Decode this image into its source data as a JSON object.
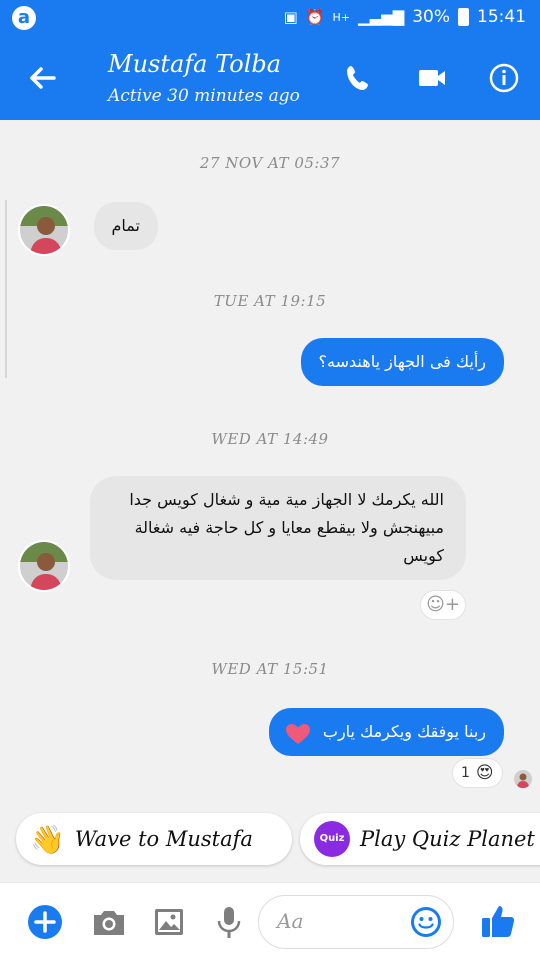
{
  "status_bar": {
    "battery": "30%",
    "time": "15:41",
    "network": "H+"
  },
  "header": {
    "contact_name": "Mustafa Tolba",
    "active_status": "Active 30 minutes ago"
  },
  "messages": [
    {
      "timestamp": "27 NOV AT 05:37"
    },
    {
      "direction": "incoming",
      "text": "تمام"
    },
    {
      "timestamp": "TUE AT 19:15"
    },
    {
      "direction": "outgoing",
      "text": "رأيك فى الجهاز ياهندسه؟"
    },
    {
      "timestamp": "WED AT 14:49"
    },
    {
      "direction": "incoming",
      "text": "الله يكرمك لا الجهاز مية مية و شغال كويس جدا مبيهنجش ولا بيقطع معايا و كل حاجة فيه شغالة كويس"
    },
    {
      "timestamp": "WED AT 15:51"
    },
    {
      "direction": "outgoing",
      "text": "ربنا يوفقك ويكرمك يارب",
      "reaction_count": "1"
    }
  ],
  "suggestions": [
    {
      "label": "Wave to Mustafa",
      "icon": "wave-hand-icon"
    },
    {
      "label": "Play Quiz Planet",
      "icon": "quiz-icon",
      "icon_text": "Quiz"
    }
  ],
  "composer": {
    "placeholder": "Aa"
  },
  "colors": {
    "accent": "#1a7bf0",
    "incoming_bubble": "#e6e6e6",
    "background": "#f1f1f1"
  }
}
